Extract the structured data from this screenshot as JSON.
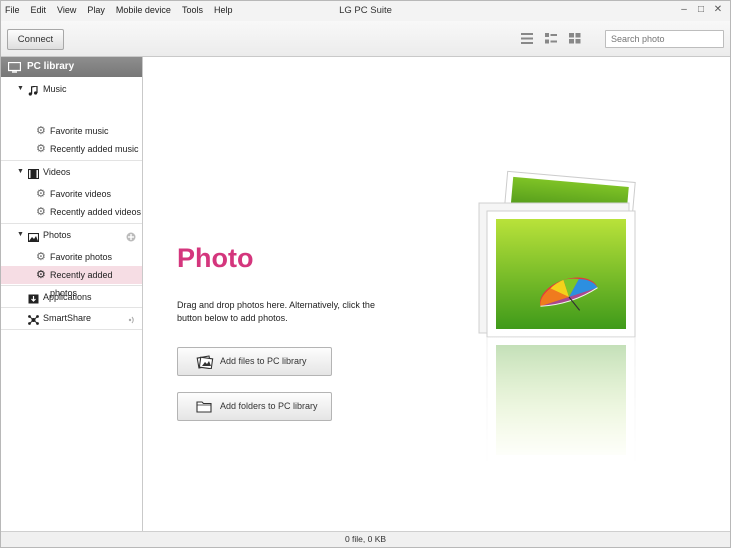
{
  "window": {
    "title": "LG PC Suite",
    "menu": [
      "File",
      "Edit",
      "View",
      "Play",
      "Mobile device",
      "Tools",
      "Help"
    ],
    "controls": {
      "minimize": "–",
      "restore": "□",
      "close": "✕"
    }
  },
  "toolbar": {
    "connect_label": "Connect",
    "search_placeholder": "Search photo",
    "view_modes": [
      "list-view-icon",
      "detail-view-icon",
      "grid-view-icon"
    ]
  },
  "sidebar": {
    "header": "PC library",
    "music": {
      "label": "Music",
      "children": [
        "Favorite music",
        "Recently added music"
      ]
    },
    "videos": {
      "label": "Videos",
      "children": [
        "Favorite videos",
        "Recently added videos"
      ]
    },
    "photos": {
      "label": "Photos",
      "children": [
        "Favorite photos",
        "Recently added photos"
      ]
    },
    "applications": "Applications",
    "smartshare": "SmartShare",
    "selected": "Recently added photos"
  },
  "main": {
    "title": "Photo",
    "description": "Drag and drop photos here. Alternatively, click the button below to add photos.",
    "add_files_label": "Add files to PC library",
    "add_folders_label": "Add folders to PC library"
  },
  "status": {
    "text": "0 file, 0 KB"
  },
  "colors": {
    "accent": "#d4367d",
    "selected_row": "#f6dde4",
    "header_bg": "#808080"
  }
}
